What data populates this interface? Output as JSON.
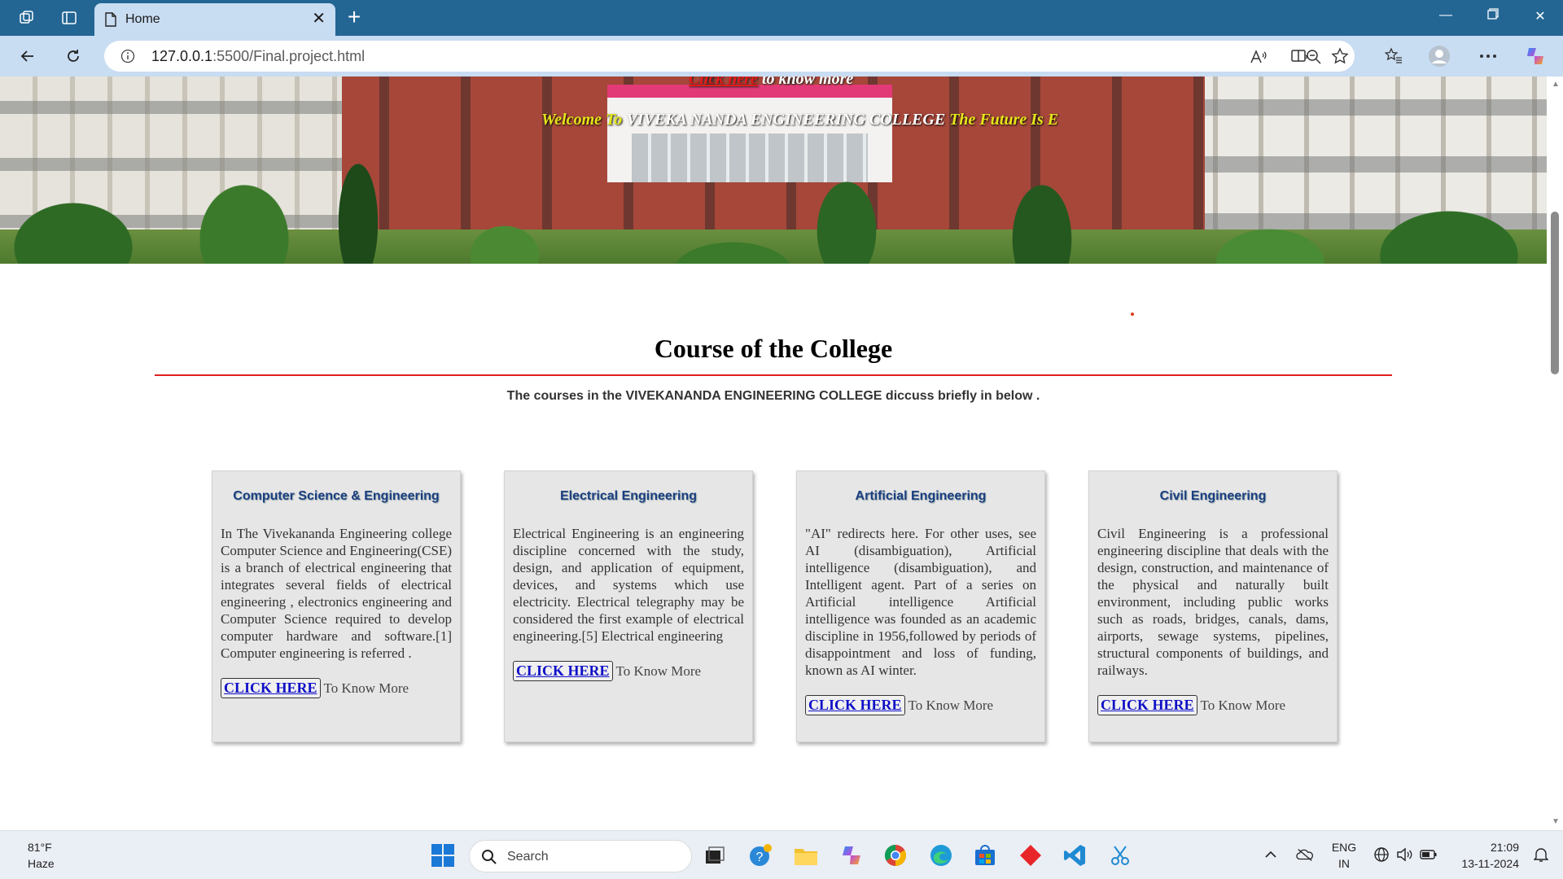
{
  "browser": {
    "tab_title": "Home",
    "url_host": "127.0.0.1",
    "url_path": ":5500/Final.project.html"
  },
  "hero": {
    "top_link": "Click here",
    "top_suffix": " to know more",
    "welcome": "Welcome To ",
    "college": " VIVEKA NANDA ENGINEERING COLLEGE ",
    "tagline": " The Future Is E"
  },
  "section": {
    "title": "Course of the College",
    "subtitle": "The courses in the  VIVEKANANDA ENGINEERING COLLEGE diccuss briefly in below ."
  },
  "cards": [
    {
      "title": "Computer Science & Engineering",
      "body": "In The Vivekananda Engineering college Computer Science and Engineering(CSE) is a branch of electrical engineering that integrates several fields of electrical engineering , electronics engineering and Computer Science required to develop computer hardware and software.[1] Computer engineering is referred .",
      "button": "CLICK HERE",
      "cta": "To Know More"
    },
    {
      "title": "Electrical Engineering",
      "body": "Electrical Engineering is an engineering discipline concerned with the study, design, and application of equipment, devices, and systems which use electricity. Electrical telegraphy may be considered the first example of electrical engineering.[5] Electrical engineering",
      "button": "CLICK HERE",
      "cta": "To Know More"
    },
    {
      "title": "Artificial Engineering",
      "body": "\"AI\" redirects here. For other uses, see AI (disambiguation), Artificial intelligence (disambiguation), and Intelligent agent. Part of a series on Artificial intelligence Artificial intelligence was founded as an academic discipline in 1956,followed by periods of disappointment and loss of funding, known as AI winter.",
      "button": "CLICK HERE",
      "cta": "To Know More"
    },
    {
      "title": "Civil Engineering",
      "body": "Civil Engineering is a professional engineering discipline that deals with the design, construction, and maintenance of the physical and naturally built environment, including public works such as roads, bridges, canals, dams, airports, sewage systems, pipelines, structural components of buildings, and railways.",
      "button": "CLICK HERE",
      "cta": "To Know More"
    }
  ],
  "taskbar": {
    "weather_temp": "81°F",
    "weather_desc": "Haze",
    "search_placeholder": "Search",
    "lang_top": "ENG",
    "lang_bottom": "IN",
    "time": "21:09",
    "date": "13-11-2024"
  },
  "colors": {
    "tabbar": "#236694",
    "toolbar": "#c8dcf2",
    "rule": "#e02020",
    "card_title": "#1a3e80",
    "click_here": "#1010c8"
  }
}
